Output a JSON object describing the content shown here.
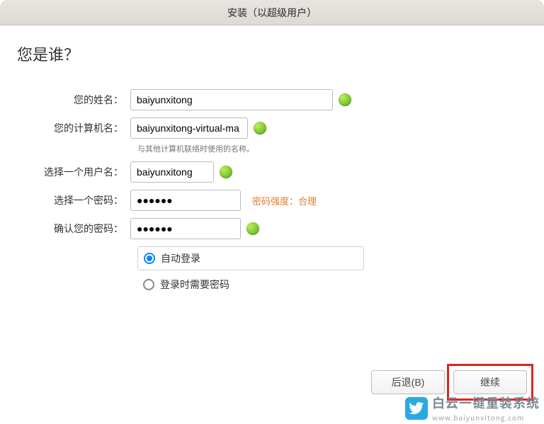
{
  "window": {
    "title": "安装（以超级用户）"
  },
  "heading": "您是谁？",
  "labels": {
    "name": "您的姓名：",
    "computer": "您的计算机名：",
    "computer_helper": "与其他计算机联络时使用的名称。",
    "username": "选择一个用户名：",
    "password": "选择一个密码：",
    "confirm": "确认您的密码："
  },
  "values": {
    "name": "baiyunxitong",
    "computer": "baiyunxitong-virtual-ma",
    "username": "baiyunxitong",
    "password": "●●●●●●",
    "confirm": "●●●●●●"
  },
  "strength": {
    "label": "密码强度：",
    "value": "合理"
  },
  "login_options": {
    "auto": "自动登录",
    "require_pw": "登录时需要密码",
    "selected": "auto"
  },
  "buttons": {
    "back": "后退(B)",
    "continue": "继续"
  },
  "watermark": {
    "brand": "白云一键重装系统",
    "url": "www.baiyunxitong.com"
  }
}
